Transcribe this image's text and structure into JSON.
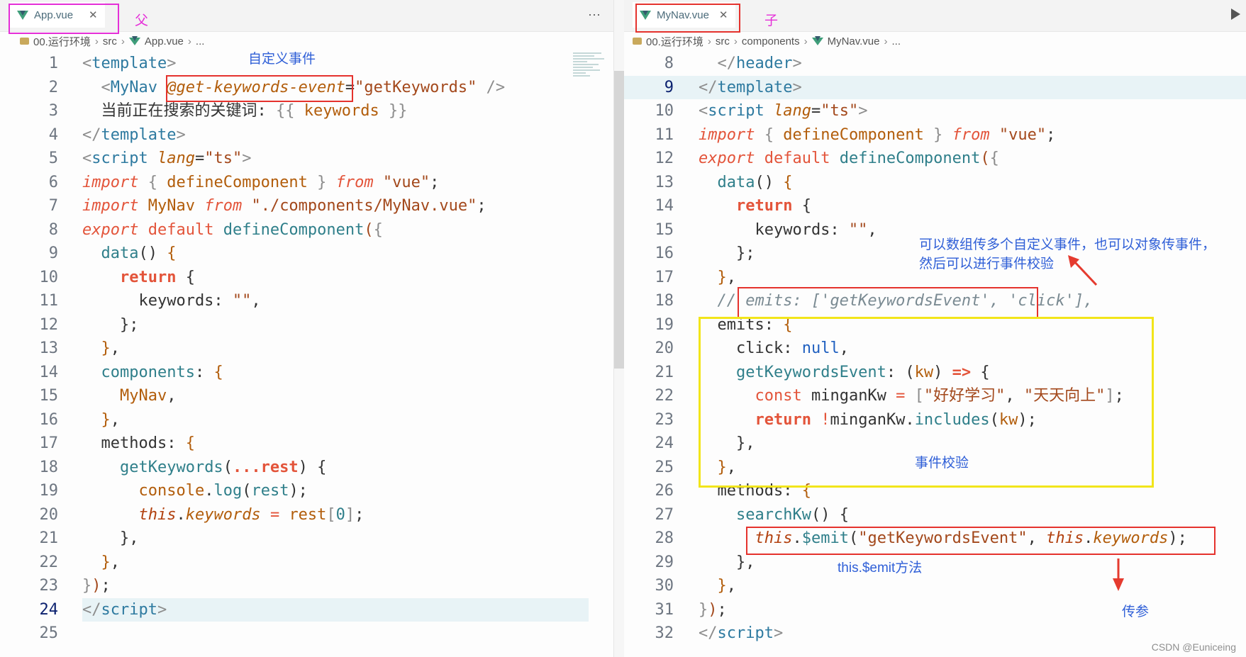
{
  "left": {
    "tab_label": "App.vue",
    "tab_annotation": "父",
    "breadcrumb": [
      "00.运行环境",
      "src",
      "App.vue",
      "..."
    ],
    "lines": [
      {
        "n": "1",
        "html": "<span class='t-br'>&lt;</span><span class='t-tag'>template</span><span class='t-br'>&gt;</span>"
      },
      {
        "n": "2",
        "html": "  <span class='t-br'>&lt;</span><span class='t-tag'>MyNav</span> <span class='t-attr'>@get-keywords-event</span>=<span class='t-str'>\"getKeywords\"</span> <span class='t-br'>/&gt;</span>"
      },
      {
        "n": "3",
        "html": "  当前正在搜索的关键词: <span class='t-br'>{{</span> <span class='t-prop' style='font-style:normal'>keywords</span> <span class='t-br'>}}</span>"
      },
      {
        "n": "4",
        "html": "<span class='t-br'>&lt;/</span><span class='t-tag'>template</span><span class='t-br'>&gt;</span>"
      },
      {
        "n": "5",
        "html": "<span class='t-br'>&lt;</span><span class='t-tag'>script</span> <span class='t-attr'>lang</span>=<span class='t-str'>\"ts\"</span><span class='t-br'>&gt;</span>"
      },
      {
        "n": "6",
        "html": "<span class='t-kw'>import</span> <span class='t-br'>{</span> <span class='t-prop' style='font-style:normal'>defineComponent</span> <span class='t-br'>}</span> <span class='t-kw'>from</span> <span class='t-str'>\"vue\"</span>;"
      },
      {
        "n": "7",
        "html": "<span class='t-kw'>import</span> <span class='t-prop' style='font-style:normal'>MyNav</span> <span class='t-kw'>from</span> <span class='t-str'>\"./components/MyNav.vue\"</span>;"
      },
      {
        "n": "8",
        "html": "<span class='t-kw'>export</span> <span class='t-kw' style='font-style:normal'>default</span> <span class='t-fn'>defineComponent</span><span class='t-str'>(</span><span class='t-br'>{</span>"
      },
      {
        "n": "9",
        "html": "  <span class='t-fn'>data</span>() <span class='t-prop' style='font-style:normal'>{</span>"
      },
      {
        "n": "10",
        "html": "    <span class='t-kw2'>return</span> {"
      },
      {
        "n": "11",
        "html": "      keywords: <span class='t-str'>\"\"</span>,"
      },
      {
        "n": "12",
        "html": "    };"
      },
      {
        "n": "13",
        "html": "  <span class='t-prop' style='font-style:normal'>}</span>,"
      },
      {
        "n": "14",
        "html": "  <span class='t-fn'>components</span>: <span class='t-prop' style='font-style:normal'>{</span>"
      },
      {
        "n": "15",
        "html": "    <span class='t-prop' style='font-style:normal'>MyNav</span>,"
      },
      {
        "n": "16",
        "html": "  <span class='t-prop' style='font-style:normal'>}</span>,"
      },
      {
        "n": "17",
        "html": "  methods: <span class='t-prop' style='font-style:normal'>{</span>"
      },
      {
        "n": "18",
        "html": "    <span class='t-fn'>getKeywords</span>(<span class='t-kw2'>...rest</span>) {"
      },
      {
        "n": "19",
        "html": "      <span class='t-prop' style='font-style:normal'>console</span>.<span class='t-fn'>log</span>(<span class='t-fn'>rest</span>);"
      },
      {
        "n": "20",
        "html": "      <span class='t-this'>this</span>.<span class='t-prop'>keywords</span> <span class='t-kw' style='font-style:normal'>=</span> <span class='t-prop' style='font-style:normal'>rest</span><span class='t-br'>[</span><span class='t-num'>0</span><span class='t-br'>]</span>;"
      },
      {
        "n": "21",
        "html": "    },"
      },
      {
        "n": "22",
        "html": "  <span class='t-prop' style='font-style:normal'>}</span>,"
      },
      {
        "n": "23",
        "html": "<span class='t-br'>}</span><span class='t-str'>)</span>;"
      },
      {
        "n": "24",
        "html": "<span class='t-br'>&lt;/</span><span class='t-tag'>script</span><span class='t-br'>&gt;</span>",
        "active": true
      },
      {
        "n": "25",
        "html": ""
      }
    ],
    "annotation_event": "自定义事件"
  },
  "right": {
    "tab_label": "MyNav.vue",
    "tab_annotation": "子",
    "breadcrumb": [
      "00.运行环境",
      "src",
      "components",
      "MyNav.vue",
      "..."
    ],
    "lines": [
      {
        "n": "8",
        "html": "  <span class='t-br'>&lt;/</span><span class='t-tag'>header</span><span class='t-br'>&gt;</span>"
      },
      {
        "n": "9",
        "html": "<span class='t-br'>&lt;/</span><span class='t-tag'>template</span><span class='t-br'>&gt;</span>",
        "hl": true
      },
      {
        "n": "10",
        "html": "<span class='t-br'>&lt;</span><span class='t-tag'>script</span> <span class='t-attr'>lang</span>=<span class='t-str'>\"ts\"</span><span class='t-br'>&gt;</span>"
      },
      {
        "n": "11",
        "html": "<span class='t-kw'>import</span> <span class='t-br'>{</span> <span class='t-prop' style='font-style:normal'>defineComponent</span> <span class='t-br'>}</span> <span class='t-kw'>from</span> <span class='t-str'>\"vue\"</span>;"
      },
      {
        "n": "12",
        "html": "<span class='t-kw'>export</span> <span class='t-kw' style='font-style:normal'>default</span> <span class='t-fn'>defineComponent</span><span class='t-str'>(</span><span class='t-br'>{</span>"
      },
      {
        "n": "13",
        "html": "  <span class='t-fn'>data</span>() <span class='t-prop' style='font-style:normal'>{</span>"
      },
      {
        "n": "14",
        "html": "    <span class='t-kw2'>return</span> {"
      },
      {
        "n": "15",
        "html": "      keywords: <span class='t-str'>\"\"</span>,"
      },
      {
        "n": "16",
        "html": "    };"
      },
      {
        "n": "17",
        "html": "  <span class='t-prop' style='font-style:normal'>}</span>,"
      },
      {
        "n": "18",
        "html": "  <span class='t-cmt'>// emits: ['getKeywordsEvent', 'click'],</span>"
      },
      {
        "n": "19",
        "html": "  emits: <span class='t-prop' style='font-style:normal'>{</span>"
      },
      {
        "n": "20",
        "html": "    click: <span class='t-null'>null</span>,"
      },
      {
        "n": "21",
        "html": "    <span class='t-fn'>getKeywordsEvent</span>: (<span class='t-prop' style='font-style:normal'>kw</span>) <span class='t-kw2'>=&gt;</span> {"
      },
      {
        "n": "22",
        "html": "      <span class='t-kw2' style='font-weight:normal'>const</span> minganKw <span class='t-kw' style='font-style:normal'>=</span> <span class='t-br'>[</span><span class='t-str'>\"好好学习\"</span>, <span class='t-str'>\"天天向上\"</span><span class='t-br'>]</span>;"
      },
      {
        "n": "23",
        "html": "      <span class='t-kw2'>return</span> <span class='t-kw' style='font-style:normal'>!</span>minganKw.<span class='t-fn'>includes</span>(<span class='t-prop' style='font-style:normal'>kw</span>);"
      },
      {
        "n": "24",
        "html": "    },"
      },
      {
        "n": "25",
        "html": "  <span class='t-prop' style='font-style:normal'>}</span>,"
      },
      {
        "n": "26",
        "html": "  methods: <span class='t-prop' style='font-style:normal'>{</span>"
      },
      {
        "n": "27",
        "html": "    <span class='t-fn'>searchKw</span>() {"
      },
      {
        "n": "28",
        "html": "      <span class='t-this'>this</span>.<span class='t-fn'>$emit</span>(<span class='t-str'>\"getKeywordsEvent\"</span>, <span class='t-this'>this</span>.<span class='t-prop'>keywords</span>);"
      },
      {
        "n": "29",
        "html": "    },"
      },
      {
        "n": "30",
        "html": "  <span class='t-prop' style='font-style:normal'>}</span>,"
      },
      {
        "n": "31",
        "html": "<span class='t-br'>}</span><span class='t-str'>)</span>;"
      },
      {
        "n": "32",
        "html": "<span class='t-br'>&lt;/</span><span class='t-tag'>script</span><span class='t-br'>&gt;</span>"
      }
    ],
    "annotation_array": "可以数组传多个自定义事件，也可以对象传事件，\n然后可以进行事件校验",
    "annotation_validate": "事件校验",
    "annotation_emit": "this.$emit方法",
    "annotation_param": "传参"
  },
  "watermark": "CSDN @Euniceing"
}
